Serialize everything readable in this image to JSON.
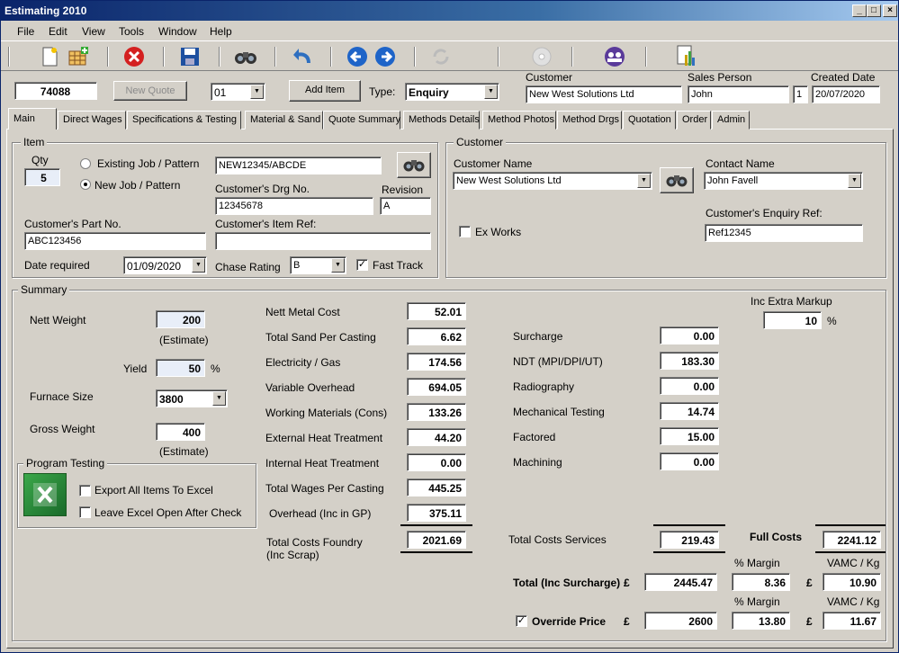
{
  "window": {
    "title": "Estimating 2010",
    "min": "_",
    "max": "□",
    "close": "×"
  },
  "menu": [
    "File",
    "Edit",
    "View",
    "Tools",
    "Window",
    "Help"
  ],
  "header": {
    "estimate_no": "74088",
    "new_quote": "New Quote",
    "revision": "01",
    "add_item": "Add Item",
    "type_label": "Type:",
    "type_value": "Enquiry",
    "customer_label": "Customer",
    "customer_value": "New West Solutions Ltd",
    "sales_label": "Sales Person",
    "sales_value": "John",
    "sales_num": "1",
    "created_label": "Created Date",
    "created_value": "20/07/2020"
  },
  "tabs": [
    "Main",
    "Direct Wages",
    "Specifications & Testing",
    "Material & Sand",
    "Quote Summary",
    "Methods Details",
    "Method Photos",
    "Method Drgs",
    "Quotation",
    "Order",
    "Admin"
  ],
  "item": {
    "title": "Item",
    "qty_label": "Qty",
    "qty": "5",
    "existing_label": "Existing Job / Pattern",
    "new_label": "New Job / Pattern",
    "job_code": "NEW12345/ABCDE",
    "drg_label": "Customer's Drg No.",
    "drg": "12345678",
    "rev_label": "Revision",
    "rev": "A",
    "part_label": "Customer's Part No.",
    "part": "ABC123456",
    "itemref_label": "Customer's Item Ref:",
    "itemref": "",
    "date_label": "Date required",
    "date": "01/09/2020",
    "chase_label": "Chase Rating",
    "chase": "B",
    "fast_label": "Fast Track",
    "fast_check": "✓"
  },
  "customer": {
    "title": "Customer",
    "name_label": "Customer Name",
    "name": "New West Solutions Ltd",
    "contact_label": "Contact Name",
    "contact": "John Favell",
    "exworks_label": "Ex Works",
    "enq_label": "Customer's Enquiry Ref:",
    "enq": "Ref12345"
  },
  "summary": {
    "title": "Summary",
    "nett_label": "Nett Weight",
    "nett": "200",
    "estimate": "(Estimate)",
    "yield_label": "Yield",
    "yield": "50",
    "pct": "%",
    "furnace_label": "Furnace Size",
    "furnace": "3800",
    "gross_label": "Gross Weight",
    "gross": "400",
    "prog_title": "Program Testing",
    "export_label": "Export All Items To Excel",
    "leave_label": "Leave Excel Open After Check",
    "costs": [
      {
        "label": "Nett Metal Cost",
        "value": "52.01"
      },
      {
        "label": "Total Sand Per Casting",
        "value": "6.62"
      },
      {
        "label": "Electricity / Gas",
        "value": "174.56"
      },
      {
        "label": "Variable Overhead",
        "value": "694.05"
      },
      {
        "label": "Working Materials (Cons)",
        "value": "133.26"
      },
      {
        "label": "External Heat Treatment",
        "value": "44.20"
      },
      {
        "label": "Internal Heat Treatment",
        "value": "0.00"
      },
      {
        "label": "Total Wages Per Casting",
        "value": "445.25"
      },
      {
        "label": "Overhead (Inc in GP)",
        "value": "375.11"
      }
    ],
    "foundry_label": "Total Costs Foundry",
    "foundry_sub": "(Inc Scrap)",
    "foundry": "2021.69",
    "services": [
      {
        "label": "Surcharge",
        "value": "0.00"
      },
      {
        "label": "NDT (MPI/DPI/UT)",
        "value": "183.30"
      },
      {
        "label": "Radiography",
        "value": "0.00"
      },
      {
        "label": "Mechanical Testing",
        "value": "14.74"
      },
      {
        "label": "Factored",
        "value": "15.00"
      },
      {
        "label": "Machining",
        "value": "0.00"
      }
    ],
    "services_total_label": "Total Costs Services",
    "services_total": "219.43",
    "markup_label": "Inc Extra Markup",
    "markup": "10",
    "full_label": "Full Costs",
    "full": "2241.12",
    "margin_label": "% Margin",
    "vamc_label": "VAMC / Kg",
    "total_label": "Total (Inc Surcharge)",
    "pound": "£",
    "total": "2445.47",
    "total_margin": "8.36",
    "total_vamc": "10.90",
    "override_label": "Override Price",
    "override": "2600",
    "override_margin": "13.80",
    "override_vamc": "11.67",
    "override_check": "✓"
  }
}
